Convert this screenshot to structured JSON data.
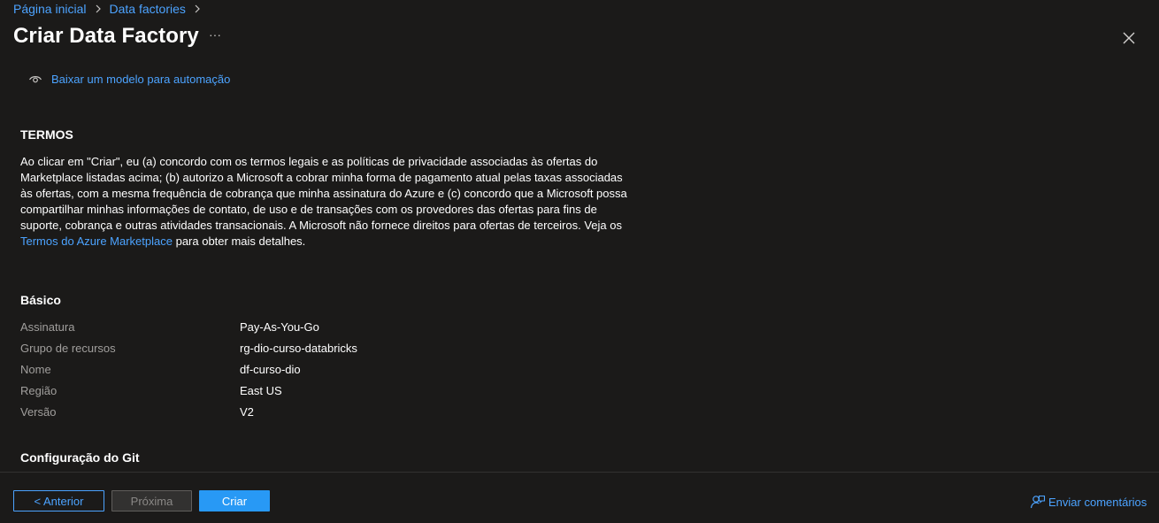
{
  "breadcrumb": {
    "items": [
      {
        "label": "Página inicial"
      },
      {
        "label": "Data factories"
      }
    ]
  },
  "header": {
    "title": "Criar Data Factory",
    "more_label": "···"
  },
  "download_link": "Baixar um modelo para automação",
  "terms": {
    "heading": "TERMOS",
    "body": "Ao clicar em \"Criar\", eu (a) concordo com os termos legais e as políticas de privacidade associadas às ofertas do Marketplace listadas acima; (b) autorizo a Microsoft a cobrar minha forma de pagamento atual pelas taxas associadas às ofertas, com a mesma frequência de cobrança que minha assinatura do Azure e (c) concordo que a Microsoft possa compartilhar minhas informações de contato, de uso e de transações com os provedores das ofertas para fins de suporte, cobrança e outras atividades transacionais. A Microsoft não fornece direitos para ofertas de terceiros. Veja os",
    "link_text": "Termos do Azure Marketplace",
    "suffix": "para obter mais detalhes."
  },
  "basics": {
    "heading": "Básico",
    "rows": [
      {
        "label": "Assinatura",
        "value": "Pay-As-You-Go"
      },
      {
        "label": "Grupo de recursos",
        "value": "rg-dio-curso-databricks"
      },
      {
        "label": "Nome",
        "value": "df-curso-dio"
      },
      {
        "label": "Região",
        "value": "East US"
      },
      {
        "label": "Versão",
        "value": "V2"
      }
    ]
  },
  "git": {
    "heading": "Configuração do Git"
  },
  "footer": {
    "prev_label": "< Anterior",
    "next_label": "Próxima",
    "create_label": "Criar",
    "feedback_label": "Enviar comentários"
  },
  "colors": {
    "background": "#1b1a19",
    "accent": "#4ca3ff",
    "primary_button": "#2899f5",
    "muted_text": "#a19f9d"
  },
  "icons": {
    "breadcrumb_separator": "chevron-right-icon",
    "download": "eye-icon",
    "close": "close-icon",
    "feedback": "feedback-person-icon"
  }
}
